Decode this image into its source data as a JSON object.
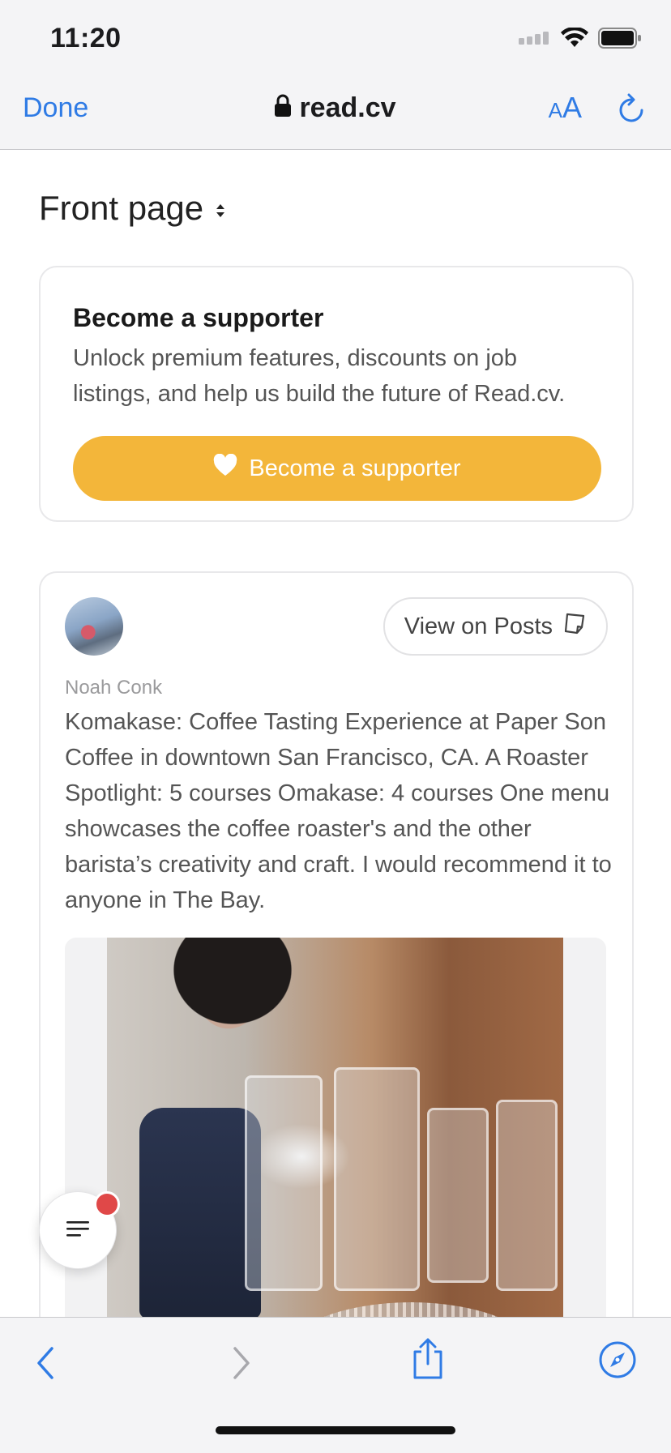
{
  "status_bar": {
    "time": "11:20",
    "icons": [
      "signal-icon",
      "wifi-icon",
      "battery-icon"
    ]
  },
  "browser": {
    "done_label": "Done",
    "url": "read.cv",
    "text_size_small": "A",
    "text_size_big": "A",
    "accent_color": "#2f7be5"
  },
  "page": {
    "title": "Front page"
  },
  "supporter_card": {
    "title": "Become a supporter",
    "description": "Unlock premium features, discounts on job listings, and help us build the future of Read.cv.",
    "button_label": "Become a supporter",
    "button_color": "#f3b63a"
  },
  "post": {
    "author": "Noah Conk",
    "view_button_label": "View on Posts",
    "text": "Komakase: Coffee Tasting Experience at Paper Son Coffee in downtown San Francisco, CA. A Roaster Spotlight: 5 courses Omakase: 4 courses One menu showcases the coffee roaster's and the other barista’s creativity and craft. I would recommend it to anyone in The Bay."
  },
  "fab": {
    "icon": "menu-lines-icon",
    "badge_color": "#e04848"
  },
  "toolbar": {
    "icons": [
      "back-icon",
      "forward-icon",
      "share-icon",
      "compass-icon"
    ]
  }
}
